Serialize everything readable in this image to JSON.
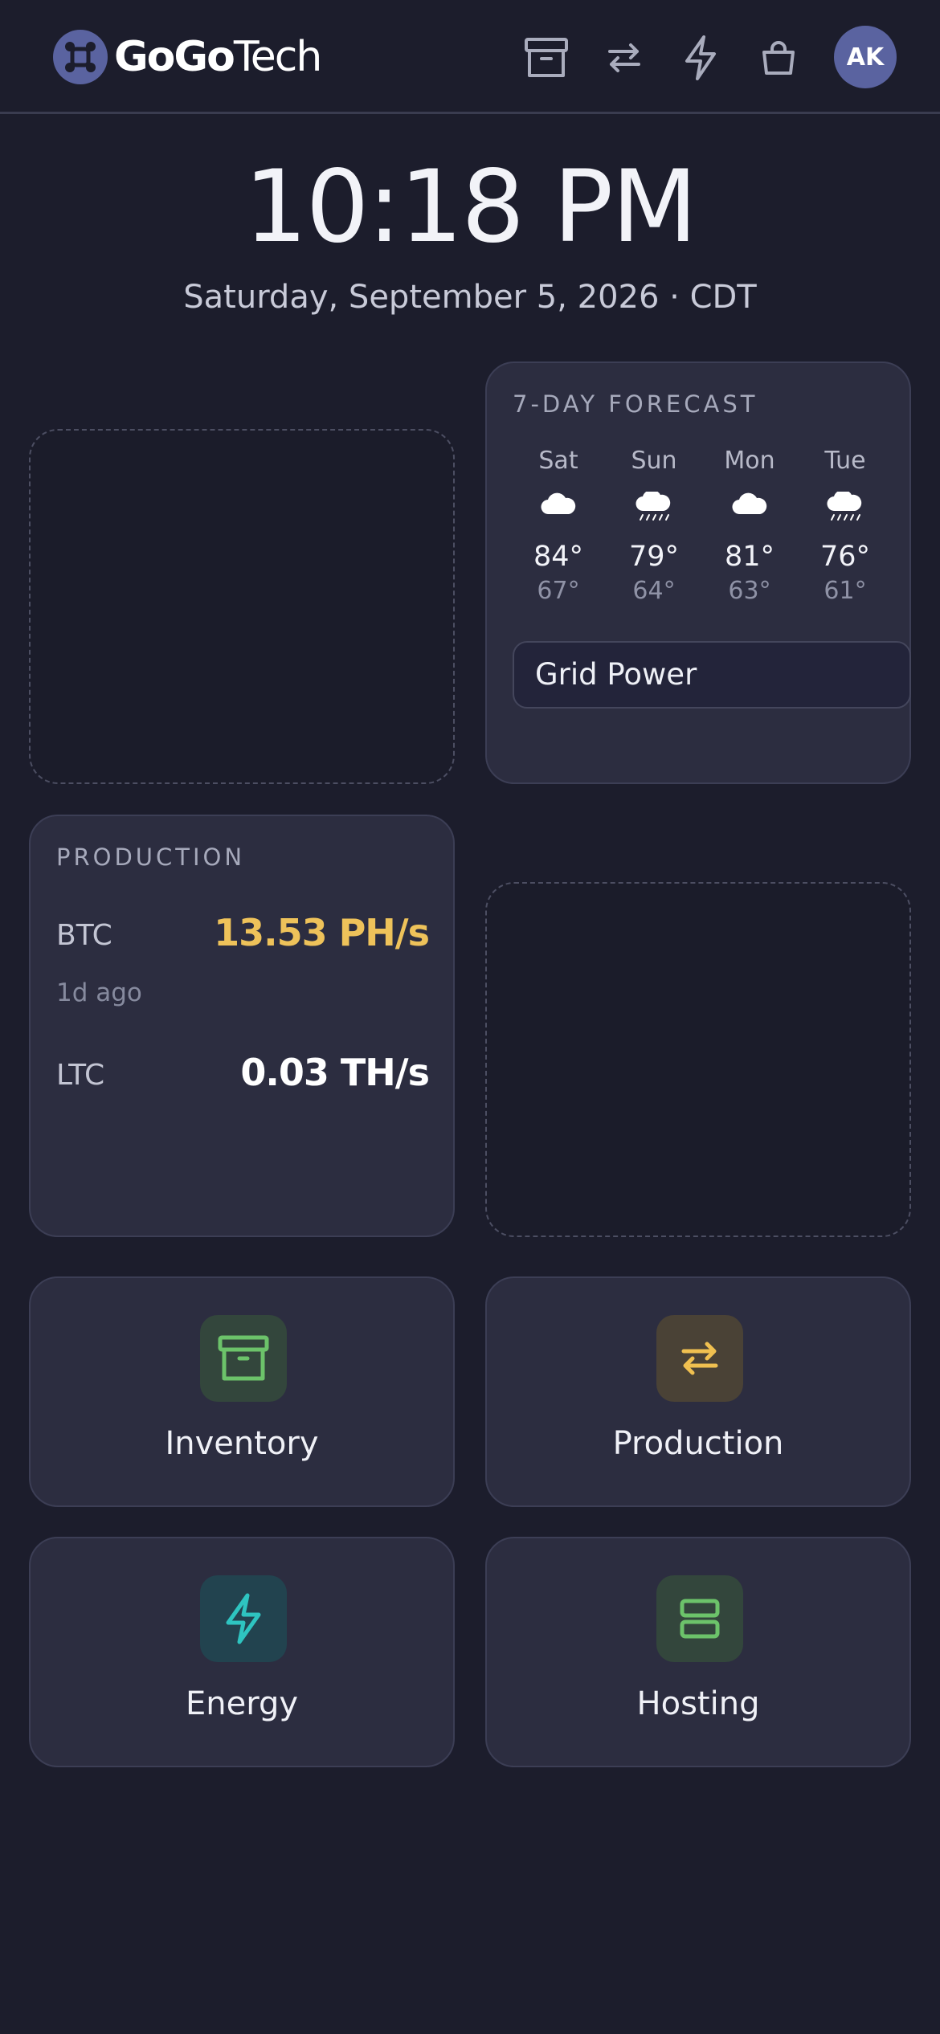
{
  "header": {
    "brand_bold": "GoGo",
    "brand_light": "Tech",
    "nav": [
      {
        "name": "inventory-nav",
        "icon": "archive-box-icon"
      },
      {
        "name": "production-nav",
        "icon": "arrows-swap-icon"
      },
      {
        "name": "energy-nav",
        "icon": "lightning-bolt-icon"
      },
      {
        "name": "shop-nav",
        "icon": "shopping-bag-icon"
      }
    ],
    "avatar_initials": "AK"
  },
  "clock": {
    "time": "10:18 PM",
    "date": "Saturday, September 5, 2026 · CDT"
  },
  "forecast": {
    "title": "7-DAY FORECAST",
    "days": [
      {
        "day": "Sat",
        "icon": "cloud-icon",
        "hi": "84°",
        "lo": "67°"
      },
      {
        "day": "Sun",
        "icon": "rain-cloud-icon",
        "hi": "79°",
        "lo": "64°"
      },
      {
        "day": "Mon",
        "icon": "cloud-icon",
        "hi": "81°",
        "lo": "63°"
      },
      {
        "day": "Tue",
        "icon": "rain-cloud-icon",
        "hi": "76°",
        "lo": "61°"
      }
    ],
    "grid_power_label": "Grid Power"
  },
  "production": {
    "title": "PRODUCTION",
    "btc_label": "BTC",
    "btc_value": "13.53 PH/s",
    "btc_updated": "1d ago",
    "ltc_label": "LTC",
    "ltc_value": "0.03 TH/s"
  },
  "tiles": [
    {
      "label": "Inventory",
      "icon": "archive-box-icon",
      "color": "#6cc36a",
      "bg": "#33463c"
    },
    {
      "label": "Production",
      "icon": "arrows-swap-icon",
      "color": "#f0c050",
      "bg": "#4a4236"
    },
    {
      "label": "Energy",
      "icon": "lightning-bolt-icon",
      "color": "#2ec4c0",
      "bg": "#22434f"
    },
    {
      "label": "Hosting",
      "icon": "server-icon",
      "color": "#6cc36a",
      "bg": "#33463c"
    }
  ],
  "colors": {
    "background": "#1c1d2c",
    "card": "#2c2d40",
    "accent_yellow": "#eec25a",
    "brand": "#5a63a0"
  }
}
